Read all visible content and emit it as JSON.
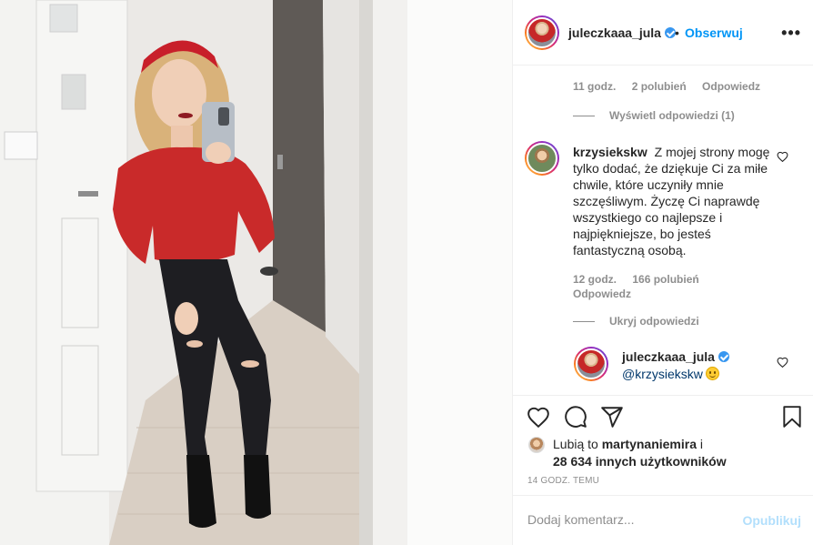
{
  "post": {
    "author": "juleczkaaa_jula",
    "follow_label": "Obserwuj",
    "separator": "•",
    "more_label": "•••"
  },
  "comments": {
    "first_meta": {
      "time": "11 godz.",
      "likes": "2 polubień",
      "reply": "Odpowiedz"
    },
    "view_replies": "Wyświetl odpowiedzi (1)",
    "second": {
      "user": "krzysiekskw",
      "text": "Z mojej strony mogę tylko dodać, że dziękuje Ci za miłe chwile, które uczyniły mnie szczęśliwym. Życzę Ci naprawdę wszystkiego co najlepsze i najpiękniejsze, bo jesteś fantastyczną osobą.",
      "time": "12 godz.",
      "likes": "166 polubień",
      "reply": "Odpowiedz"
    },
    "hide_replies": "Ukryj odpowiedzi",
    "reply": {
      "user": "juleczkaaa_jula",
      "mention": "@krzysiekskw"
    }
  },
  "likes": {
    "prefix": "Lubią to ",
    "first_user": "martynaniemira",
    "suffix": " i",
    "others": "28 634 innych użytkowników"
  },
  "timestamp": "14 GODZ. TEMU",
  "composer": {
    "placeholder": "Dodaj komentarz...",
    "publish_label": "Opublikuj"
  },
  "colors": {
    "accent": "#0095f6",
    "verified": "#3897f0",
    "muted": "#8e8e8e",
    "publish_disabled": "#b2dffc"
  },
  "icons": [
    "more-options-icon",
    "verified-icon",
    "heart-icon",
    "comment-icon",
    "share-icon",
    "bookmark-icon",
    "smile-emoji-icon"
  ]
}
